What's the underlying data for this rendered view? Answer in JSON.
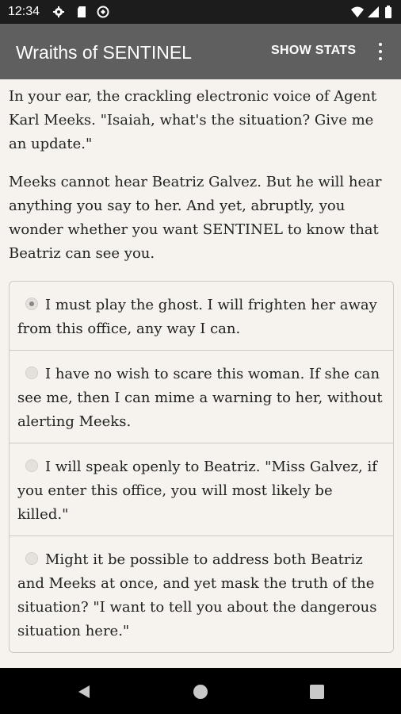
{
  "status_bar": {
    "time": "12:34",
    "left_icons": [
      "gear-icon",
      "sd-card-icon",
      "sync-icon"
    ],
    "right_icons": [
      "wifi-icon",
      "cellular-icon",
      "battery-icon"
    ]
  },
  "app_bar": {
    "title": "Wraiths of SENTINEL",
    "show_stats_label": "SHOW STATS",
    "menu_icon": "more-vert-icon"
  },
  "story": {
    "paragraphs": [
      "In your ear, the crackling electronic voice of Agent Karl Meeks. \"Isaiah, what's the situation? Give me an update.\"",
      "Meeks cannot hear Beatriz Galvez. But he will hear anything you say to her. And yet, abruptly, you wonder whether you want SENTINEL to know that Beatriz can see you."
    ]
  },
  "choices": {
    "selected_index": 0,
    "options": [
      "I must play the ghost. I will frighten her away from this office, any way I can.",
      "I have no wish to scare this woman. If she can see me, then I can mime a warning to her, without alerting Meeks.",
      "I will speak openly to Beatriz. \"Miss Galvez, if you enter this office, you will most likely be killed.\"",
      "Might it be possible to address both Beatriz and Meeks at once, and yet mask the truth of the situation? \"I want to tell you about the dangerous situation here.\""
    ]
  },
  "nav_bar": {
    "buttons": [
      "back-icon",
      "home-icon",
      "recents-icon"
    ]
  }
}
